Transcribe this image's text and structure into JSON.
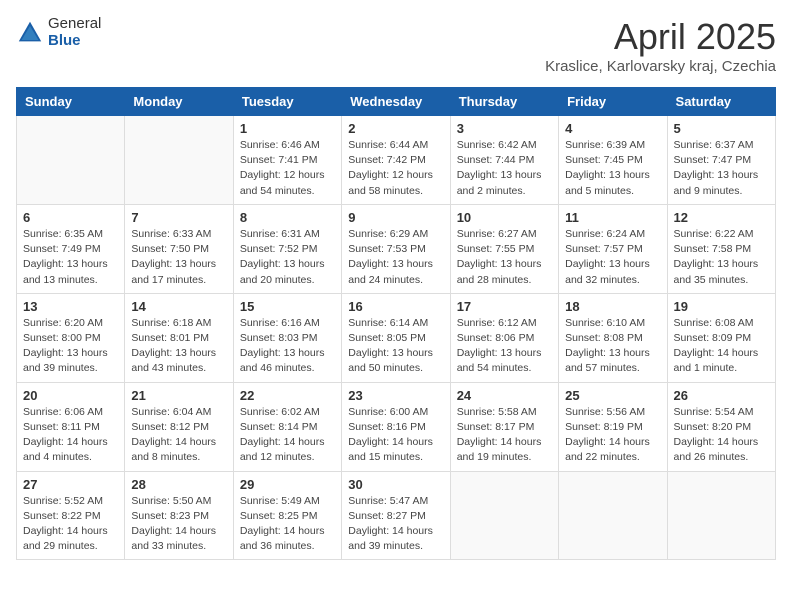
{
  "logo": {
    "general": "General",
    "blue": "Blue"
  },
  "title": "April 2025",
  "location": "Kraslice, Karlovarsky kraj, Czechia",
  "days_header": [
    "Sunday",
    "Monday",
    "Tuesday",
    "Wednesday",
    "Thursday",
    "Friday",
    "Saturday"
  ],
  "weeks": [
    [
      {
        "day": "",
        "sunrise": "",
        "sunset": "",
        "daylight": ""
      },
      {
        "day": "",
        "sunrise": "",
        "sunset": "",
        "daylight": ""
      },
      {
        "day": "1",
        "sunrise": "Sunrise: 6:46 AM",
        "sunset": "Sunset: 7:41 PM",
        "daylight": "Daylight: 12 hours and 54 minutes."
      },
      {
        "day": "2",
        "sunrise": "Sunrise: 6:44 AM",
        "sunset": "Sunset: 7:42 PM",
        "daylight": "Daylight: 12 hours and 58 minutes."
      },
      {
        "day": "3",
        "sunrise": "Sunrise: 6:42 AM",
        "sunset": "Sunset: 7:44 PM",
        "daylight": "Daylight: 13 hours and 2 minutes."
      },
      {
        "day": "4",
        "sunrise": "Sunrise: 6:39 AM",
        "sunset": "Sunset: 7:45 PM",
        "daylight": "Daylight: 13 hours and 5 minutes."
      },
      {
        "day": "5",
        "sunrise": "Sunrise: 6:37 AM",
        "sunset": "Sunset: 7:47 PM",
        "daylight": "Daylight: 13 hours and 9 minutes."
      }
    ],
    [
      {
        "day": "6",
        "sunrise": "Sunrise: 6:35 AM",
        "sunset": "Sunset: 7:49 PM",
        "daylight": "Daylight: 13 hours and 13 minutes."
      },
      {
        "day": "7",
        "sunrise": "Sunrise: 6:33 AM",
        "sunset": "Sunset: 7:50 PM",
        "daylight": "Daylight: 13 hours and 17 minutes."
      },
      {
        "day": "8",
        "sunrise": "Sunrise: 6:31 AM",
        "sunset": "Sunset: 7:52 PM",
        "daylight": "Daylight: 13 hours and 20 minutes."
      },
      {
        "day": "9",
        "sunrise": "Sunrise: 6:29 AM",
        "sunset": "Sunset: 7:53 PM",
        "daylight": "Daylight: 13 hours and 24 minutes."
      },
      {
        "day": "10",
        "sunrise": "Sunrise: 6:27 AM",
        "sunset": "Sunset: 7:55 PM",
        "daylight": "Daylight: 13 hours and 28 minutes."
      },
      {
        "day": "11",
        "sunrise": "Sunrise: 6:24 AM",
        "sunset": "Sunset: 7:57 PM",
        "daylight": "Daylight: 13 hours and 32 minutes."
      },
      {
        "day": "12",
        "sunrise": "Sunrise: 6:22 AM",
        "sunset": "Sunset: 7:58 PM",
        "daylight": "Daylight: 13 hours and 35 minutes."
      }
    ],
    [
      {
        "day": "13",
        "sunrise": "Sunrise: 6:20 AM",
        "sunset": "Sunset: 8:00 PM",
        "daylight": "Daylight: 13 hours and 39 minutes."
      },
      {
        "day": "14",
        "sunrise": "Sunrise: 6:18 AM",
        "sunset": "Sunset: 8:01 PM",
        "daylight": "Daylight: 13 hours and 43 minutes."
      },
      {
        "day": "15",
        "sunrise": "Sunrise: 6:16 AM",
        "sunset": "Sunset: 8:03 PM",
        "daylight": "Daylight: 13 hours and 46 minutes."
      },
      {
        "day": "16",
        "sunrise": "Sunrise: 6:14 AM",
        "sunset": "Sunset: 8:05 PM",
        "daylight": "Daylight: 13 hours and 50 minutes."
      },
      {
        "day": "17",
        "sunrise": "Sunrise: 6:12 AM",
        "sunset": "Sunset: 8:06 PM",
        "daylight": "Daylight: 13 hours and 54 minutes."
      },
      {
        "day": "18",
        "sunrise": "Sunrise: 6:10 AM",
        "sunset": "Sunset: 8:08 PM",
        "daylight": "Daylight: 13 hours and 57 minutes."
      },
      {
        "day": "19",
        "sunrise": "Sunrise: 6:08 AM",
        "sunset": "Sunset: 8:09 PM",
        "daylight": "Daylight: 14 hours and 1 minute."
      }
    ],
    [
      {
        "day": "20",
        "sunrise": "Sunrise: 6:06 AM",
        "sunset": "Sunset: 8:11 PM",
        "daylight": "Daylight: 14 hours and 4 minutes."
      },
      {
        "day": "21",
        "sunrise": "Sunrise: 6:04 AM",
        "sunset": "Sunset: 8:12 PM",
        "daylight": "Daylight: 14 hours and 8 minutes."
      },
      {
        "day": "22",
        "sunrise": "Sunrise: 6:02 AM",
        "sunset": "Sunset: 8:14 PM",
        "daylight": "Daylight: 14 hours and 12 minutes."
      },
      {
        "day": "23",
        "sunrise": "Sunrise: 6:00 AM",
        "sunset": "Sunset: 8:16 PM",
        "daylight": "Daylight: 14 hours and 15 minutes."
      },
      {
        "day": "24",
        "sunrise": "Sunrise: 5:58 AM",
        "sunset": "Sunset: 8:17 PM",
        "daylight": "Daylight: 14 hours and 19 minutes."
      },
      {
        "day": "25",
        "sunrise": "Sunrise: 5:56 AM",
        "sunset": "Sunset: 8:19 PM",
        "daylight": "Daylight: 14 hours and 22 minutes."
      },
      {
        "day": "26",
        "sunrise": "Sunrise: 5:54 AM",
        "sunset": "Sunset: 8:20 PM",
        "daylight": "Daylight: 14 hours and 26 minutes."
      }
    ],
    [
      {
        "day": "27",
        "sunrise": "Sunrise: 5:52 AM",
        "sunset": "Sunset: 8:22 PM",
        "daylight": "Daylight: 14 hours and 29 minutes."
      },
      {
        "day": "28",
        "sunrise": "Sunrise: 5:50 AM",
        "sunset": "Sunset: 8:23 PM",
        "daylight": "Daylight: 14 hours and 33 minutes."
      },
      {
        "day": "29",
        "sunrise": "Sunrise: 5:49 AM",
        "sunset": "Sunset: 8:25 PM",
        "daylight": "Daylight: 14 hours and 36 minutes."
      },
      {
        "day": "30",
        "sunrise": "Sunrise: 5:47 AM",
        "sunset": "Sunset: 8:27 PM",
        "daylight": "Daylight: 14 hours and 39 minutes."
      },
      {
        "day": "",
        "sunrise": "",
        "sunset": "",
        "daylight": ""
      },
      {
        "day": "",
        "sunrise": "",
        "sunset": "",
        "daylight": ""
      },
      {
        "day": "",
        "sunrise": "",
        "sunset": "",
        "daylight": ""
      }
    ]
  ]
}
